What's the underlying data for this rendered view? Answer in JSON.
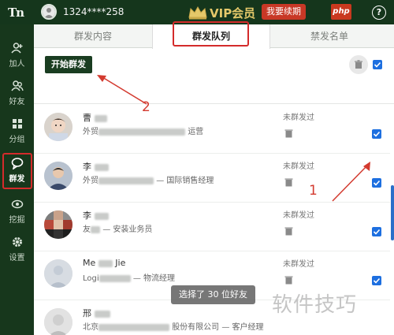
{
  "app": {
    "logo": "Tn",
    "phone": "1324****258",
    "vip_label": "VIP会员",
    "renew_label": "我要续期",
    "php_badge": "php",
    "help": "?"
  },
  "sidebar": {
    "items": [
      {
        "label": "加人",
        "icon": "add-person-icon"
      },
      {
        "label": "好友",
        "icon": "friends-icon"
      },
      {
        "label": "分组",
        "icon": "group-grid-icon"
      },
      {
        "label": "群发",
        "icon": "chat-bubble-icon",
        "active": true
      },
      {
        "label": "挖掘",
        "icon": "eye-icon"
      },
      {
        "label": "设置",
        "icon": "gear-icon"
      }
    ]
  },
  "tabs": [
    {
      "label": "群发内容"
    },
    {
      "label": "群发队列",
      "active": true
    },
    {
      "label": "禁发名单"
    }
  ],
  "toolbar": {
    "start_label": "开始群发"
  },
  "rows": [
    {
      "name": "曹",
      "sub_prefix": "外贸",
      "sub_suffix": "运营",
      "status": "未群发过"
    },
    {
      "name": "李",
      "sub_prefix": "外贸",
      "sub_suffix": "— 国际销售经理",
      "status": "未群发过"
    },
    {
      "name": "李",
      "sub_prefix": "友",
      "sub_suffix": "— 安装业务员",
      "status": "未群发过"
    },
    {
      "name": "Me",
      "name_suffix": "Jie",
      "sub_prefix": "Logi",
      "sub_suffix": "— 物流经理",
      "status": "未群发过"
    },
    {
      "name": "邢",
      "sub_prefix": "北京",
      "sub_suffix": "股份有限公司 — 客户经理",
      "status": ""
    }
  ],
  "toast": "选择了 30 位好友",
  "annotations": {
    "one": "1",
    "two": "2"
  },
  "watermark": "软件技巧",
  "colors": {
    "top_bar": "#15361c",
    "sidebar": "#17371c",
    "vip_gold": "#e4c86a",
    "renew_red": "#c83826",
    "checkbox_blue": "#1d6fe0",
    "highlight_red": "#d42b2b"
  }
}
